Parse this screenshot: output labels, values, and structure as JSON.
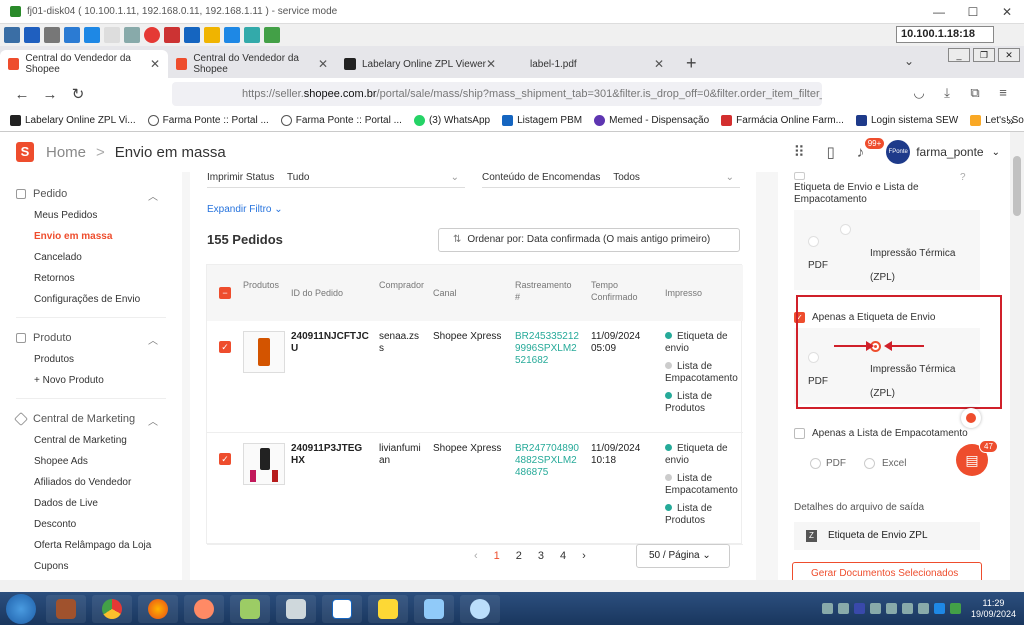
{
  "window": {
    "title": "fj01-disk04 ( 10.100.1.11, 192.168.0.11, 192.168.1.11 ) - service mode",
    "ip": "10.100.1.18:18"
  },
  "tabs": [
    {
      "label": "Central do Vendedor da Shopee"
    },
    {
      "label": "Central do Vendedor da Shopee"
    },
    {
      "label": "Labelary Online ZPL Viewer"
    },
    {
      "label": "label-1.pdf"
    }
  ],
  "url": {
    "prefix": "https://seller.",
    "domain": "shopee.com.br",
    "rest": "/portal/sale/mass/ship?mass_shipment_tab=301&filter.is_drop_off=0&filter.order_item_filter_ty"
  },
  "bookmarks": [
    "Labelary Online ZPL Vi...",
    "Farma Ponte :: Portal ...",
    "Farma Ponte :: Portal ...",
    "(3) WhatsApp",
    "Listagem PBM",
    "Memed - Dispensação",
    "Farmácia Online Farm...",
    "Login sistema SEW",
    "Let's! Sorocaba - Cons..."
  ],
  "header": {
    "home": "Home",
    "sep": ">",
    "current": "Envio em massa",
    "badge": "99+",
    "user": "farma_ponte",
    "avatar_text": "FPonte"
  },
  "sidebar": {
    "sections": [
      {
        "title": "Pedido",
        "items": [
          "Meus Pedidos",
          "Envio em massa",
          "Cancelado",
          "Retornos",
          "Configurações de Envio"
        ]
      },
      {
        "title": "Produto",
        "items": [
          "Produtos",
          "+ Novo Produto"
        ]
      },
      {
        "title": "Central de Marketing",
        "items": [
          "Central de Marketing",
          "Shopee Ads",
          "Afiliados do Vendedor",
          "Dados de Live",
          "Desconto",
          "Oferta Relâmpago da Loja",
          "Cupons"
        ]
      }
    ]
  },
  "filters": {
    "print_status_label": "Imprimir Status",
    "print_status_value": "Tudo",
    "content_label": "Conteúdo de Encomendas",
    "content_value": "Todos",
    "expand": "Expandir Filtro"
  },
  "orders": {
    "count": "155 Pedidos",
    "sort": "Ordenar por: Data confirmada (O mais antigo primeiro)",
    "columns": [
      "Produtos",
      "ID do Pedido",
      "Comprador",
      "Canal",
      "Rastreamento #",
      "Tempo Confirmado",
      "Impresso"
    ],
    "rows": [
      {
        "id": "240911NJCFTJCU",
        "buyer": "senaa.zss",
        "channel": "Shopee Xpress",
        "tracking": "BR2453352129996SPXLM2521682",
        "date": "11/09/2024",
        "time": "05:09",
        "printed": [
          "Etiqueta de envio",
          "Lista de Empacotamento",
          "Lista de Produtos"
        ]
      },
      {
        "id": "240911P3JTEGHX",
        "buyer": "livianfumian",
        "channel": "Shopee Xpress",
        "tracking": "BR2477048904882SPXLM2486875",
        "date": "11/09/2024",
        "time": "10:18",
        "printed": [
          "Etiqueta de envio",
          "Lista de Empacotamento",
          "Lista de Produtos"
        ]
      }
    ]
  },
  "pagination": {
    "pages": [
      "1",
      "2",
      "3",
      "4"
    ],
    "per_page": "50 / Página"
  },
  "panel": {
    "top_label": "Etiqueta de Envio e Lista de Empacotamento",
    "pdf": "PDF",
    "zpl_line1": "Impressão Térmica",
    "zpl_line2": "(ZPL)",
    "only_label": "Apenas a Etiqueta de Envio",
    "only_pack": "Apenas a Lista de Empacotamento",
    "excel": "Excel",
    "output_title": "Detalhes do arquivo de saída",
    "output_file": "Etiqueta de Envio ZPL",
    "generate": "Gerar Documentos Selecionados"
  },
  "chat": {
    "badge": "47"
  },
  "clock": {
    "time": "11:29",
    "date": "19/09/2024"
  },
  "colors": {
    "accent": "#ee4d2d",
    "highlight_box": "#d0202a",
    "tracking": "#26aa99",
    "link": "#2673dd"
  }
}
